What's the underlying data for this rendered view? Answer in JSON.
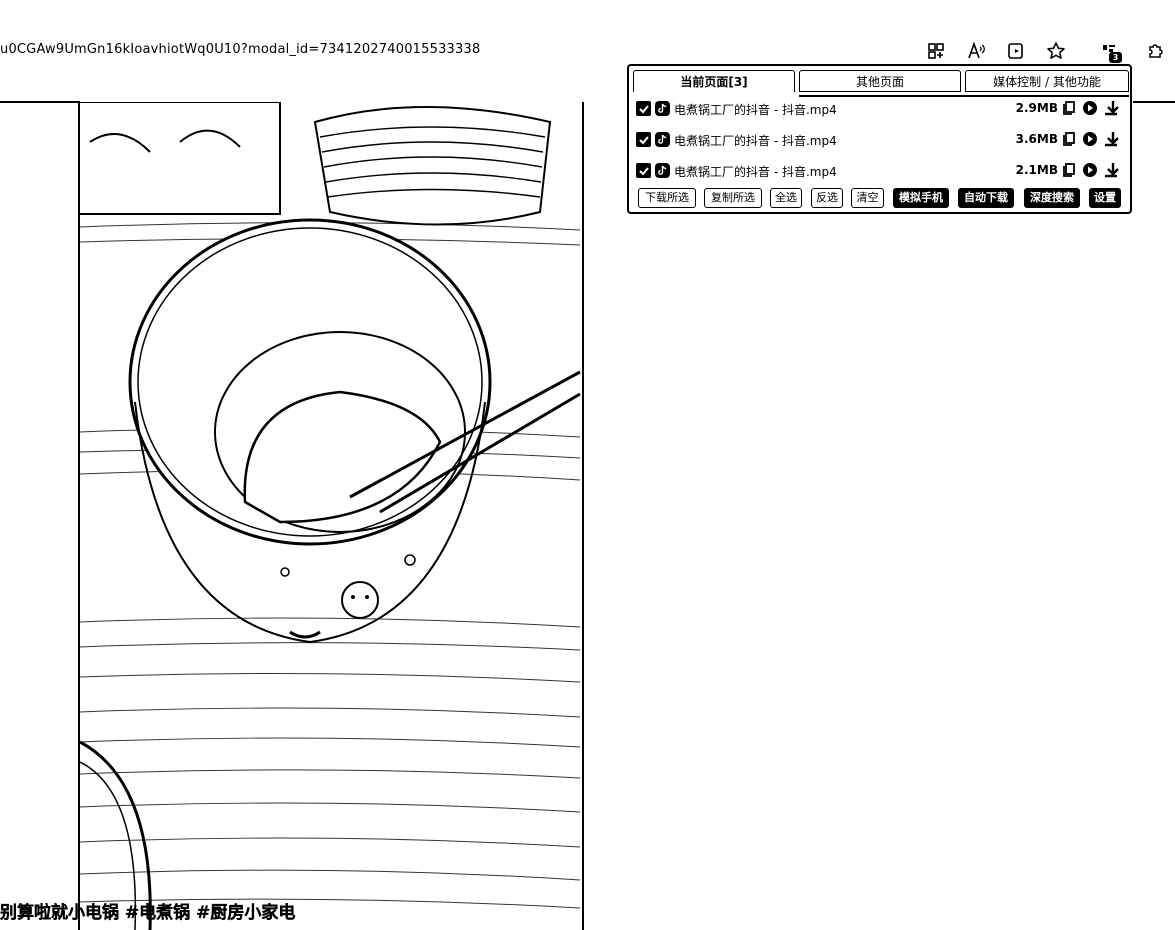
{
  "browser": {
    "url": "u0CGAw9UmGn16kIoavhiotWq0U10?modal_id=7341202740015533338",
    "extension_badge": "3",
    "toolbar_icons": [
      "split-screen-icon",
      "read-aloud-icon",
      "immersive-reader-icon",
      "favorite-star-icon",
      "extension-icon",
      "extensions-puzzle-icon"
    ]
  },
  "video": {
    "caption": "别算啦就小电锅 #电煮锅 #厨房小家电"
  },
  "popup": {
    "tabs": [
      {
        "label": "当前页面[3]",
        "active": true
      },
      {
        "label": "其他页面",
        "active": false
      },
      {
        "label": "媒体控制 / 其他功能",
        "active": false
      }
    ],
    "items": [
      {
        "checked": true,
        "source_icon": "tiktok-icon",
        "name": "电煮锅工厂的抖音 - 抖音.mp4",
        "size": "2.9MB"
      },
      {
        "checked": true,
        "source_icon": "tiktok-icon",
        "name": "电煮锅工厂的抖音 - 抖音.mp4",
        "size": "3.6MB"
      },
      {
        "checked": true,
        "source_icon": "tiktok-icon",
        "name": "电煮锅工厂的抖音 - 抖音.mp4",
        "size": "2.1MB"
      }
    ],
    "buttons": {
      "download_selected": "下载所选",
      "copy_selected": "复制所选",
      "select_all": "全选",
      "invert_selection": "反选",
      "clear": "清空",
      "simulate_phone": "模拟手机",
      "auto_download": "自动下载",
      "deep_search": "深度搜索",
      "settings": "设置"
    }
  }
}
